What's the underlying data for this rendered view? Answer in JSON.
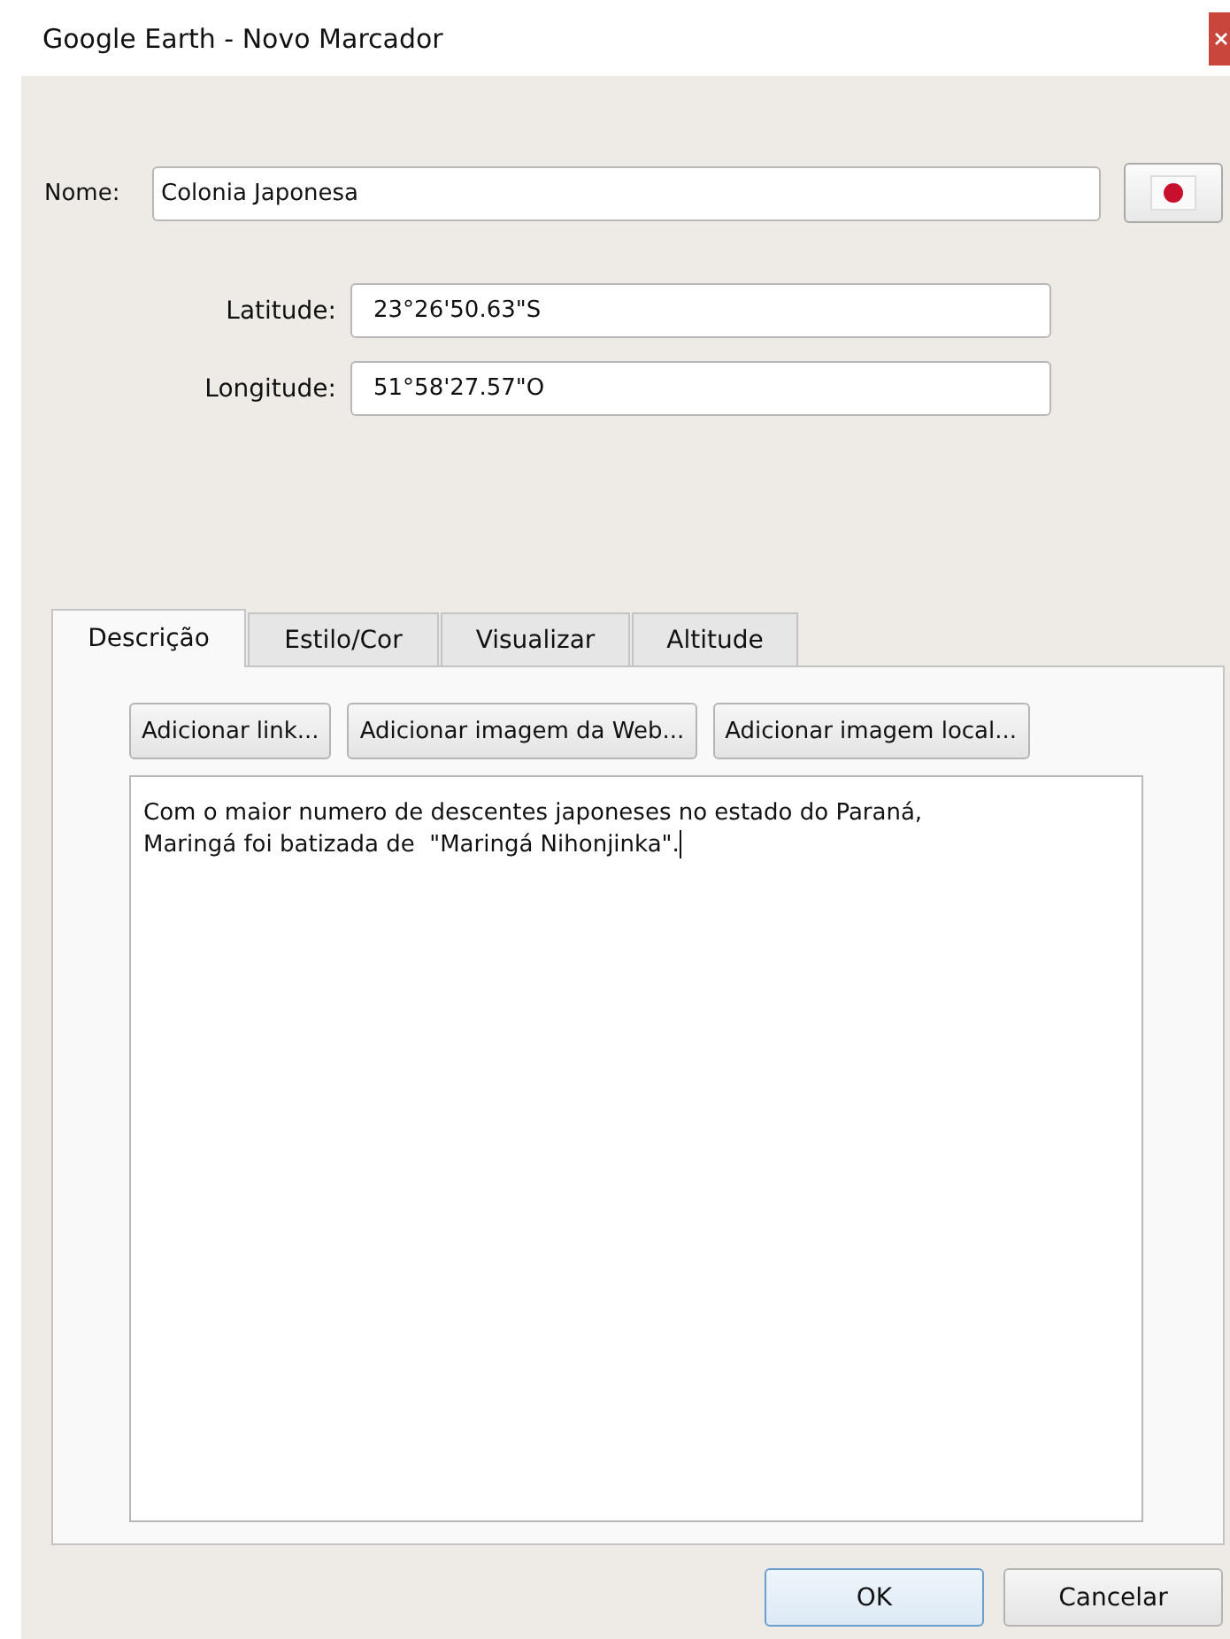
{
  "window": {
    "title": "Google Earth - Novo Marcador"
  },
  "name_field": {
    "label": "Nome:",
    "value": "Colonia Japonesa"
  },
  "coordinates": [
    {
      "label": "Latitude:",
      "value": "23°26'50.63\"S"
    },
    {
      "label": "Longitude:",
      "value": "51°58'27.57\"O"
    }
  ],
  "tabs": [
    {
      "label": "Descrição",
      "selected": true
    },
    {
      "label": "Estilo/Cor",
      "selected": false
    },
    {
      "label": "Visualizar",
      "selected": false
    },
    {
      "label": "Altitude",
      "selected": false
    }
  ],
  "description_buttons": [
    "Adicionar link...",
    "Adicionar imagem da Web...",
    "Adicionar imagem local..."
  ],
  "description": "Com o maior numero de descentes japoneses no estado do Paraná,\nMaringá foi batizada de  \"Maringá Nihonjinka\".",
  "buttons": [
    {
      "label": "OK",
      "default": true
    },
    {
      "label": "Cancelar",
      "default": false
    }
  ]
}
